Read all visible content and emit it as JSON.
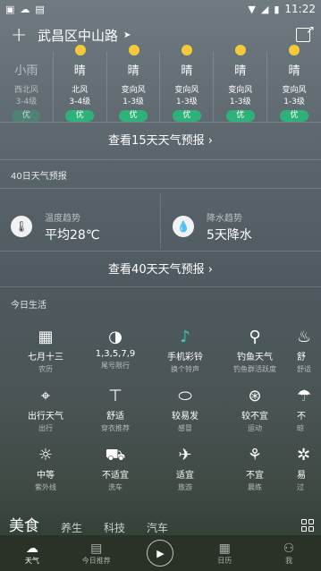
{
  "status": {
    "time": "11:22"
  },
  "header": {
    "city": "武昌区中山路"
  },
  "forecast": [
    {
      "weather": "小雨",
      "wind": "西北风",
      "level": "3-4级",
      "aqi": "优"
    },
    {
      "weather": "晴",
      "wind": "北风",
      "level": "3-4级",
      "aqi": "优"
    },
    {
      "weather": "晴",
      "wind": "变向风",
      "level": "1-3级",
      "aqi": "优"
    },
    {
      "weather": "晴",
      "wind": "变向风",
      "level": "1-3级",
      "aqi": "优"
    },
    {
      "weather": "晴",
      "wind": "变向风",
      "level": "1-3级",
      "aqi": "优"
    },
    {
      "weather": "晴",
      "wind": "变向风",
      "level": "1-3级",
      "aqi": "优"
    }
  ],
  "links": {
    "forecast15": "查看15天天气预报",
    "forecast40": "查看40天天气预报"
  },
  "forty": {
    "title": "40日天气预报",
    "temp_label": "温度趋势",
    "temp_value": "平均28℃",
    "rain_label": "降水趋势",
    "rain_value": "5天降水"
  },
  "life": {
    "title": "今日生活",
    "rows": [
      [
        {
          "icon": "calendar-icon",
          "value": "七月十三",
          "label": "农历"
        },
        {
          "icon": "half-circle-icon",
          "value": "1,3,5,7,9",
          "label": "尾号限行"
        },
        {
          "icon": "music-note-icon",
          "value": "手机彩铃",
          "label": "换个铃声"
        },
        {
          "icon": "fishing-icon",
          "value": "钓鱼天气",
          "label": "钓鱼群活跃度"
        },
        {
          "icon": "comfort-icon",
          "value": "舒",
          "label": "舒适"
        }
      ],
      [
        {
          "icon": "location-pin-icon",
          "value": "出行天气",
          "label": "出行"
        },
        {
          "icon": "shirt-icon",
          "value": "舒适",
          "label": "穿衣推荐"
        },
        {
          "icon": "pill-icon",
          "value": "较易发",
          "label": "感冒"
        },
        {
          "icon": "ball-icon",
          "value": "较不宜",
          "label": "运动"
        },
        {
          "icon": "umbrella-icon",
          "value": "不",
          "label": "晾"
        }
      ],
      [
        {
          "icon": "sun-uv-icon",
          "value": "中等",
          "label": "紫外线"
        },
        {
          "icon": "car-icon",
          "value": "不适宜",
          "label": "洗车"
        },
        {
          "icon": "plane-icon",
          "value": "适宜",
          "label": "旅游"
        },
        {
          "icon": "runner-icon",
          "value": "不宜",
          "label": "晨练"
        },
        {
          "icon": "gear-icon",
          "value": "易",
          "label": "过"
        }
      ]
    ]
  },
  "categories": [
    "美食",
    "养生",
    "科技",
    "汽车"
  ],
  "nav": {
    "weather": "天气",
    "recommend": "今日推荐",
    "calendar": "日历",
    "me": "我"
  }
}
